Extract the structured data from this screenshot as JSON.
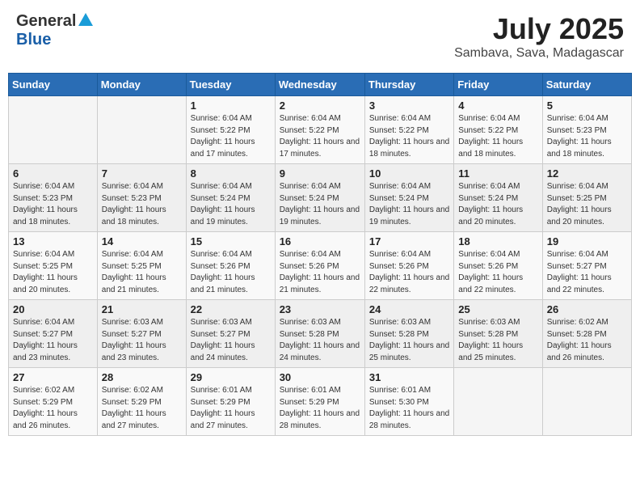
{
  "header": {
    "logo_general": "General",
    "logo_blue": "Blue",
    "month_title": "July 2025",
    "location": "Sambava, Sava, Madagascar"
  },
  "days_of_week": [
    "Sunday",
    "Monday",
    "Tuesday",
    "Wednesday",
    "Thursday",
    "Friday",
    "Saturday"
  ],
  "weeks": [
    [
      {
        "day": "",
        "detail": ""
      },
      {
        "day": "",
        "detail": ""
      },
      {
        "day": "1",
        "detail": "Sunrise: 6:04 AM\nSunset: 5:22 PM\nDaylight: 11 hours and 17 minutes."
      },
      {
        "day": "2",
        "detail": "Sunrise: 6:04 AM\nSunset: 5:22 PM\nDaylight: 11 hours and 17 minutes."
      },
      {
        "day": "3",
        "detail": "Sunrise: 6:04 AM\nSunset: 5:22 PM\nDaylight: 11 hours and 18 minutes."
      },
      {
        "day": "4",
        "detail": "Sunrise: 6:04 AM\nSunset: 5:22 PM\nDaylight: 11 hours and 18 minutes."
      },
      {
        "day": "5",
        "detail": "Sunrise: 6:04 AM\nSunset: 5:23 PM\nDaylight: 11 hours and 18 minutes."
      }
    ],
    [
      {
        "day": "6",
        "detail": "Sunrise: 6:04 AM\nSunset: 5:23 PM\nDaylight: 11 hours and 18 minutes."
      },
      {
        "day": "7",
        "detail": "Sunrise: 6:04 AM\nSunset: 5:23 PM\nDaylight: 11 hours and 18 minutes."
      },
      {
        "day": "8",
        "detail": "Sunrise: 6:04 AM\nSunset: 5:24 PM\nDaylight: 11 hours and 19 minutes."
      },
      {
        "day": "9",
        "detail": "Sunrise: 6:04 AM\nSunset: 5:24 PM\nDaylight: 11 hours and 19 minutes."
      },
      {
        "day": "10",
        "detail": "Sunrise: 6:04 AM\nSunset: 5:24 PM\nDaylight: 11 hours and 19 minutes."
      },
      {
        "day": "11",
        "detail": "Sunrise: 6:04 AM\nSunset: 5:24 PM\nDaylight: 11 hours and 20 minutes."
      },
      {
        "day": "12",
        "detail": "Sunrise: 6:04 AM\nSunset: 5:25 PM\nDaylight: 11 hours and 20 minutes."
      }
    ],
    [
      {
        "day": "13",
        "detail": "Sunrise: 6:04 AM\nSunset: 5:25 PM\nDaylight: 11 hours and 20 minutes."
      },
      {
        "day": "14",
        "detail": "Sunrise: 6:04 AM\nSunset: 5:25 PM\nDaylight: 11 hours and 21 minutes."
      },
      {
        "day": "15",
        "detail": "Sunrise: 6:04 AM\nSunset: 5:26 PM\nDaylight: 11 hours and 21 minutes."
      },
      {
        "day": "16",
        "detail": "Sunrise: 6:04 AM\nSunset: 5:26 PM\nDaylight: 11 hours and 21 minutes."
      },
      {
        "day": "17",
        "detail": "Sunrise: 6:04 AM\nSunset: 5:26 PM\nDaylight: 11 hours and 22 minutes."
      },
      {
        "day": "18",
        "detail": "Sunrise: 6:04 AM\nSunset: 5:26 PM\nDaylight: 11 hours and 22 minutes."
      },
      {
        "day": "19",
        "detail": "Sunrise: 6:04 AM\nSunset: 5:27 PM\nDaylight: 11 hours and 22 minutes."
      }
    ],
    [
      {
        "day": "20",
        "detail": "Sunrise: 6:04 AM\nSunset: 5:27 PM\nDaylight: 11 hours and 23 minutes."
      },
      {
        "day": "21",
        "detail": "Sunrise: 6:03 AM\nSunset: 5:27 PM\nDaylight: 11 hours and 23 minutes."
      },
      {
        "day": "22",
        "detail": "Sunrise: 6:03 AM\nSunset: 5:27 PM\nDaylight: 11 hours and 24 minutes."
      },
      {
        "day": "23",
        "detail": "Sunrise: 6:03 AM\nSunset: 5:28 PM\nDaylight: 11 hours and 24 minutes."
      },
      {
        "day": "24",
        "detail": "Sunrise: 6:03 AM\nSunset: 5:28 PM\nDaylight: 11 hours and 25 minutes."
      },
      {
        "day": "25",
        "detail": "Sunrise: 6:03 AM\nSunset: 5:28 PM\nDaylight: 11 hours and 25 minutes."
      },
      {
        "day": "26",
        "detail": "Sunrise: 6:02 AM\nSunset: 5:28 PM\nDaylight: 11 hours and 26 minutes."
      }
    ],
    [
      {
        "day": "27",
        "detail": "Sunrise: 6:02 AM\nSunset: 5:29 PM\nDaylight: 11 hours and 26 minutes."
      },
      {
        "day": "28",
        "detail": "Sunrise: 6:02 AM\nSunset: 5:29 PM\nDaylight: 11 hours and 27 minutes."
      },
      {
        "day": "29",
        "detail": "Sunrise: 6:01 AM\nSunset: 5:29 PM\nDaylight: 11 hours and 27 minutes."
      },
      {
        "day": "30",
        "detail": "Sunrise: 6:01 AM\nSunset: 5:29 PM\nDaylight: 11 hours and 28 minutes."
      },
      {
        "day": "31",
        "detail": "Sunrise: 6:01 AM\nSunset: 5:30 PM\nDaylight: 11 hours and 28 minutes."
      },
      {
        "day": "",
        "detail": ""
      },
      {
        "day": "",
        "detail": ""
      }
    ]
  ]
}
